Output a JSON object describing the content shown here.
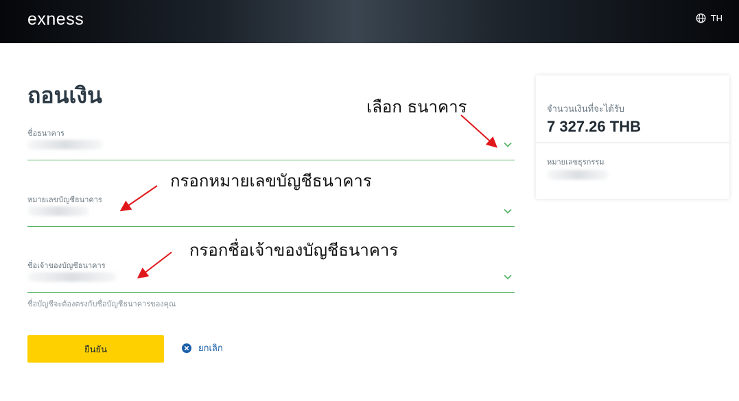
{
  "header": {
    "logo": "exness",
    "language": "TH"
  },
  "page": {
    "title": "ถอนเงิน"
  },
  "form": {
    "fields": [
      {
        "label": "ชื่อธนาคาร"
      },
      {
        "label": "หมายเลขบัญชีธนาคาร"
      },
      {
        "label": "ชื่อเจ้าของบัญชีธนาคาร"
      }
    ],
    "hint": "ชื่อบัญชีจะต้องตรงกับชื่อบัญชีธนาคารของคุณ",
    "confirm_label": "ยืนยัน",
    "cancel_label": "ยกเลิก"
  },
  "annotations": {
    "select_bank": "เลือก ธนาคาร",
    "fill_account_number": "กรอกหมายเลขบัญชีธนาคาร",
    "fill_account_owner": "กรอกชื่อเจ้าของบัญชีธนาคาร"
  },
  "summary": {
    "receive_label": "จำนวนเงินที่จะได้รับ",
    "receive_amount": "7 327.26 THB",
    "transaction_label": "หมายเลขธุรกรรม"
  },
  "colors": {
    "accent": "#ffd000",
    "field_valid": "#58b368",
    "link": "#1a5fa8",
    "annotation_arrow": "#e0171b"
  }
}
